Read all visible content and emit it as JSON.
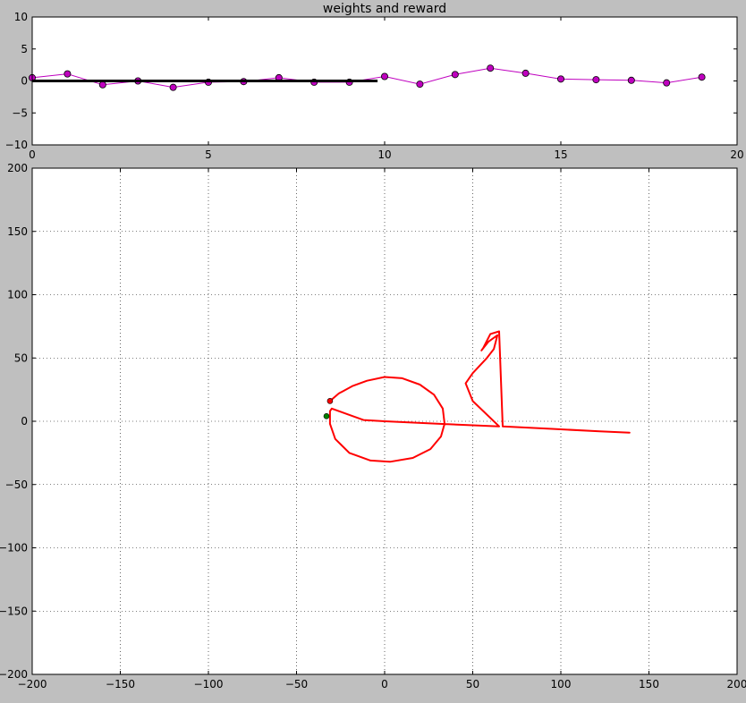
{
  "figure": {
    "background": "#bfbfbf"
  },
  "chart_data": [
    {
      "type": "line",
      "title": "weights and reward",
      "xlabel": "",
      "ylabel": "",
      "xlim": [
        0,
        20
      ],
      "ylim": [
        -10,
        10
      ],
      "xticks": [
        0,
        5,
        10,
        15,
        20
      ],
      "yticks": [
        -10,
        -5,
        0,
        5,
        10
      ],
      "grid": false,
      "series": [
        {
          "style": "line-with-markers",
          "color": "#bf00bf",
          "marker_color": "#bf00bf",
          "x": [
            0,
            1,
            2,
            3,
            4,
            5,
            6,
            7,
            8,
            9,
            10,
            11,
            12,
            13,
            14,
            15,
            16,
            17,
            18,
            19
          ],
          "y": [
            0.5,
            1.1,
            -0.6,
            0.0,
            -1.0,
            -0.2,
            -0.1,
            0.5,
            -0.2,
            -0.2,
            0.7,
            -0.5,
            1.0,
            2.0,
            1.2,
            0.3,
            0.2,
            0.1,
            -0.3,
            0.6
          ]
        },
        {
          "style": "thick-line",
          "color": "#000000",
          "x": [
            0,
            9.8
          ],
          "y": [
            0,
            0
          ]
        }
      ]
    },
    {
      "type": "line",
      "title": "",
      "xlabel": "",
      "ylabel": "",
      "xlim": [
        -200,
        200
      ],
      "ylim": [
        -200,
        200
      ],
      "xticks": [
        -200,
        -150,
        -100,
        -50,
        0,
        50,
        100,
        150,
        200
      ],
      "yticks": [
        -200,
        -150,
        -100,
        -50,
        0,
        50,
        100,
        150,
        200
      ],
      "grid": true,
      "series": [
        {
          "style": "trajectory",
          "color": "#ff0000",
          "x": [
            -31,
            -26,
            -18,
            -10,
            0,
            10,
            20,
            28,
            33,
            34,
            32,
            26,
            16,
            3,
            -8,
            -20,
            -28,
            -31,
            -31,
            -30,
            -24,
            -18,
            -12,
            0,
            30,
            65,
            50,
            46,
            50,
            58,
            62,
            64,
            59,
            55,
            56,
            60,
            65,
            67,
            95,
            122,
            139
          ],
          "y": [
            16,
            22,
            28,
            32,
            35,
            34,
            29,
            21,
            10,
            -2,
            -12,
            -22,
            -29,
            -32,
            -31,
            -25,
            -14,
            -2,
            8,
            10,
            7,
            4,
            1,
            0,
            -2,
            -4,
            16,
            30,
            38,
            50,
            57,
            68,
            63,
            56,
            58,
            69,
            71,
            -4,
            -6,
            -8,
            -9
          ]
        },
        {
          "style": "point",
          "color": "#ff0000",
          "x": [
            -31
          ],
          "y": [
            16
          ]
        },
        {
          "style": "point",
          "color": "#008000",
          "x": [
            -33
          ],
          "y": [
            4
          ]
        }
      ]
    }
  ]
}
